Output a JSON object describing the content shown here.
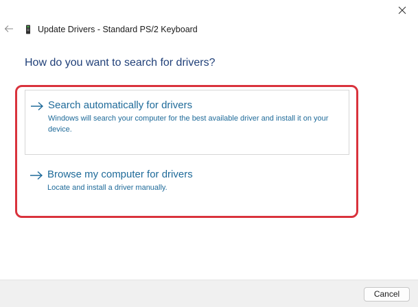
{
  "window": {
    "title": "Update Drivers - Standard PS/2 Keyboard",
    "close_icon": "close-icon",
    "back_icon": "back-arrow-icon",
    "device_icon": "keyboard-device-icon"
  },
  "main": {
    "heading": "How do you want to search for drivers?",
    "options": [
      {
        "title": "Search automatically for drivers",
        "description": "Windows will search your computer for the best available driver and install it on your device.",
        "icon": "arrow-right-icon"
      },
      {
        "title": "Browse my computer for drivers",
        "description": "Locate and install a driver manually.",
        "icon": "arrow-right-icon"
      }
    ],
    "highlight_color": "#d9323c",
    "accent_color": "#1e6a99"
  },
  "footer": {
    "cancel_label": "Cancel"
  }
}
